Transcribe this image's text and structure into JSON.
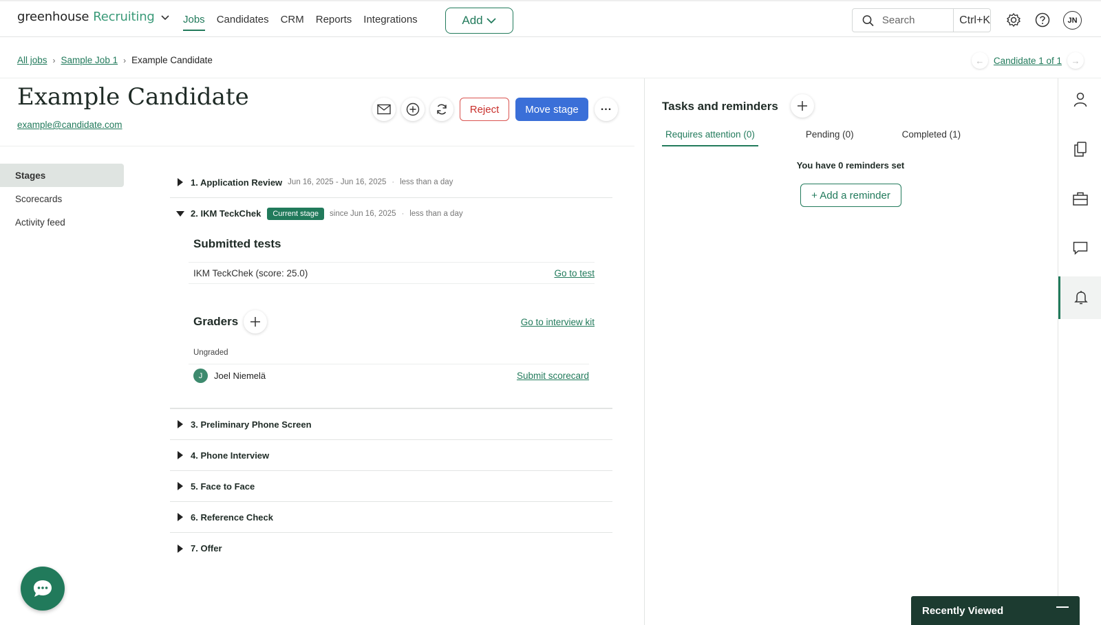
{
  "app": {
    "logo_main": "greenhouse",
    "logo_product": "Recruiting"
  },
  "nav": {
    "items": [
      {
        "label": "Jobs",
        "active": true
      },
      {
        "label": "Candidates"
      },
      {
        "label": "CRM"
      },
      {
        "label": "Reports"
      },
      {
        "label": "Integrations"
      }
    ],
    "add_label": "Add"
  },
  "search": {
    "placeholder": "Search",
    "shortcut": "Ctrl+K"
  },
  "user": {
    "initials": "JN"
  },
  "breadcrumb": {
    "all_jobs": "All jobs",
    "job": "Sample Job 1",
    "current": "Example Candidate"
  },
  "candidate_nav": {
    "label": "Candidate 1 of 1"
  },
  "candidate": {
    "name": "Example Candidate",
    "email": "example@candidate.com"
  },
  "actions": {
    "reject": "Reject",
    "move_stage": "Move stage"
  },
  "left_menu": {
    "items": [
      "Stages",
      "Scorecards",
      "Activity feed"
    ]
  },
  "stages": [
    {
      "title": "1. Application Review",
      "dates": "Jun 16, 2025 - Jun 16, 2025",
      "duration": "less than a day"
    },
    {
      "title": "2. IKM TeckChek",
      "badge": "Current stage",
      "dates": "since Jun 16, 2025",
      "duration": "less than a day"
    },
    {
      "title": "3. Preliminary Phone Screen"
    },
    {
      "title": "4. Phone Interview"
    },
    {
      "title": "5. Face to Face"
    },
    {
      "title": "6. Reference Check"
    },
    {
      "title": "7. Offer"
    }
  ],
  "current_stage": {
    "submitted_tests_title": "Submitted tests",
    "test": "IKM TeckChek (score: 25.0)",
    "go_to_test": "Go to test",
    "graders_title": "Graders",
    "interview_kit": "Go to interview kit",
    "ungraded": "Ungraded",
    "grader_initial": "J",
    "grader_name": "Joel Niemelä",
    "submit_scorecard": "Submit scorecard"
  },
  "tasks": {
    "title": "Tasks and reminders",
    "tabs": [
      "Requires attention (0)",
      "Pending (0)",
      "Completed (1)"
    ],
    "empty": "You have 0 reminders set",
    "add_reminder": "+ Add a reminder"
  },
  "recently_viewed": {
    "label": "Recently Viewed"
  },
  "colors": {
    "brand": "#217a5b",
    "primary": "#3a6fd8",
    "danger": "#c9302c"
  }
}
